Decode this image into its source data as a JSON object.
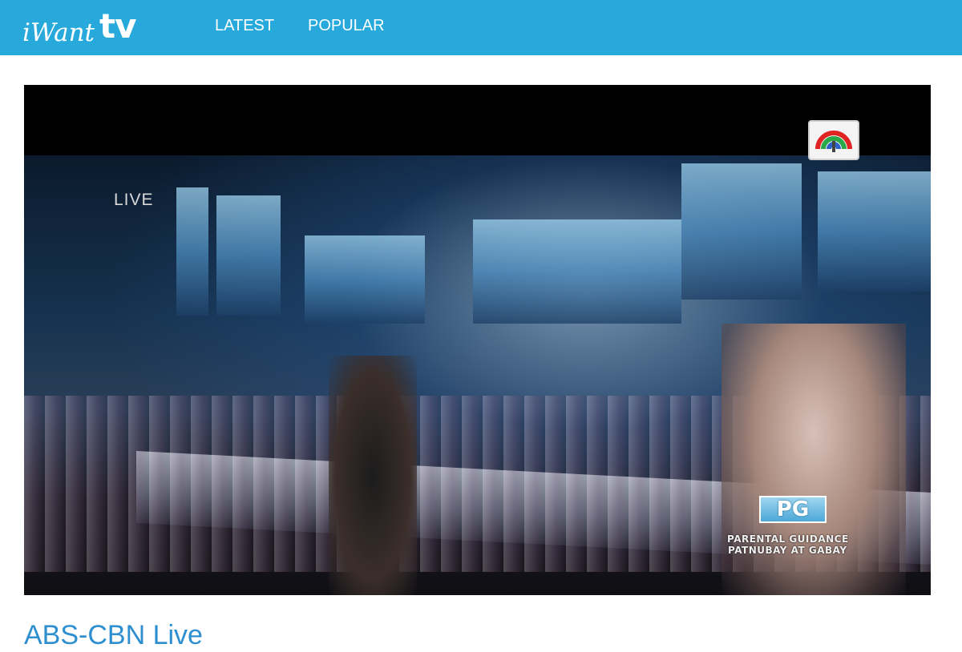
{
  "header": {
    "logo": {
      "prefix": "iWant",
      "suffix": "tv"
    },
    "nav": [
      {
        "label": "LATEST"
      },
      {
        "label": "POPULAR"
      }
    ],
    "background_color": "#27a9dc"
  },
  "player": {
    "live_label": "LIVE",
    "network_logo_icon": "abs-cbn-network-logo",
    "rating": {
      "badge": "PG",
      "line1": "PARENTAL GUIDANCE",
      "line2": "PATNUBAY AT GABAY"
    }
  },
  "video": {
    "title": "ABS-CBN Live",
    "title_color": "#2d8fcf"
  }
}
